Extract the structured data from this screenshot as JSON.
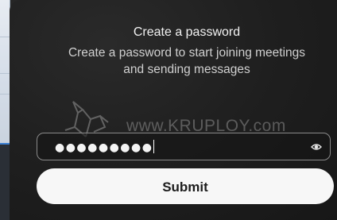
{
  "dialog": {
    "title": "Create a password",
    "subtitle_line1": "Create a password to start joining meetings",
    "subtitle_line2": "and sending messages"
  },
  "password_field": {
    "masked_value": "●●●●●●●●●",
    "icon": "eye-icon"
  },
  "submit": {
    "label": "Submit"
  },
  "watermark": {
    "text": "www.KRUPLOY.com",
    "logo": "ploy-logo"
  },
  "colors": {
    "dialog_bg": "#1f1f1f",
    "button_bg": "#f7f7f7",
    "field_border": "#8a8a8a",
    "accent_line": "#3b7fd1"
  }
}
